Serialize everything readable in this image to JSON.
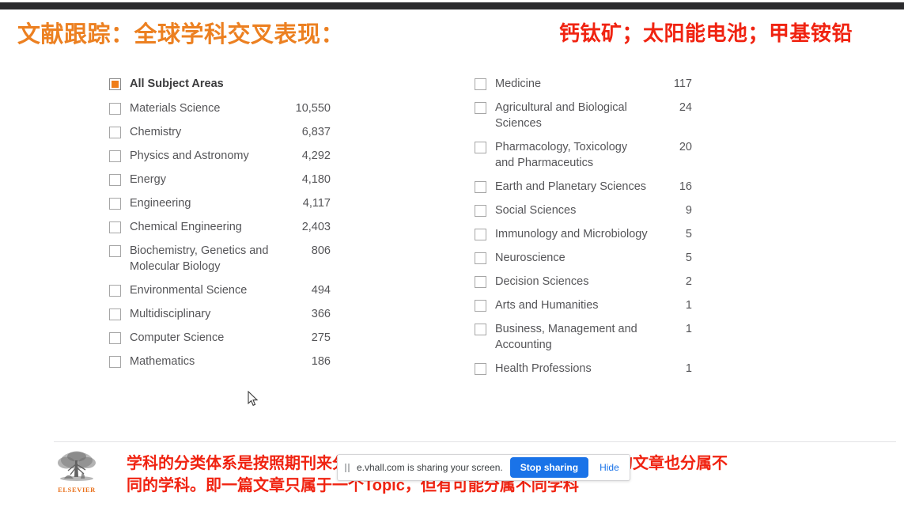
{
  "headings": {
    "left_title": "文献跟踪：全球学科交叉表现：",
    "right_title": "钙钛矿；太阳能电池；甲基铵铅",
    "left_color": "#ec8021",
    "right_color": "#f02311"
  },
  "facet_panel": {
    "accent_color": "#ef7d19",
    "left_column": [
      {
        "label": "All Subject Areas",
        "count": "",
        "checked": true
      },
      {
        "label": "Materials Science",
        "count": "10,550",
        "checked": false
      },
      {
        "label": "Chemistry",
        "count": "6,837",
        "checked": false
      },
      {
        "label": "Physics and Astronomy",
        "count": "4,292",
        "checked": false
      },
      {
        "label": "Energy",
        "count": "4,180",
        "checked": false
      },
      {
        "label": "Engineering",
        "count": "4,117",
        "checked": false
      },
      {
        "label": "Chemical Engineering",
        "count": "2,403",
        "checked": false
      },
      {
        "label": "Biochemistry, Genetics and Molecular Biology",
        "count": "806",
        "checked": false
      },
      {
        "label": "Environmental Science",
        "count": "494",
        "checked": false
      },
      {
        "label": "Multidisciplinary",
        "count": "366",
        "checked": false
      },
      {
        "label": "Computer Science",
        "count": "275",
        "checked": false
      },
      {
        "label": "Mathematics",
        "count": "186",
        "checked": false
      }
    ],
    "right_column": [
      {
        "label": "Medicine",
        "count": "117",
        "checked": false
      },
      {
        "label": "Agricultural and Biological Sciences",
        "count": "24",
        "checked": false
      },
      {
        "label": "Pharmacology, Toxicology and Pharmaceutics",
        "count": "20",
        "checked": false
      },
      {
        "label": "Earth and Planetary Sciences",
        "count": "16",
        "checked": false
      },
      {
        "label": "Social Sciences",
        "count": "9",
        "checked": false
      },
      {
        "label": "Immunology and Microbiology",
        "count": "5",
        "checked": false
      },
      {
        "label": "Neuroscience",
        "count": "5",
        "checked": false
      },
      {
        "label": "Decision Sciences",
        "count": "2",
        "checked": false
      },
      {
        "label": "Arts and Humanities",
        "count": "1",
        "checked": false
      },
      {
        "label": "Business, Management and Accounting",
        "count": "1",
        "checked": false
      },
      {
        "label": "Health Professions",
        "count": "1",
        "checked": false
      }
    ]
  },
  "footer": {
    "logo_word": "ELSEVIER",
    "logo_color": "#e9711c",
    "note_line1": "学科的分类体系是按照期刊来分的，如果期刊分属不同的学科，则期刊的文章也分属不",
    "note_line2": "同的学科。即一篇文章只属于一个Topic，但有可能分属不同学科",
    "note_color": "#f02311"
  },
  "share_bar": {
    "message": "e.vhall.com is sharing your screen.",
    "stop_label": "Stop sharing",
    "hide_label": "Hide",
    "button_color": "#1a73e8"
  }
}
